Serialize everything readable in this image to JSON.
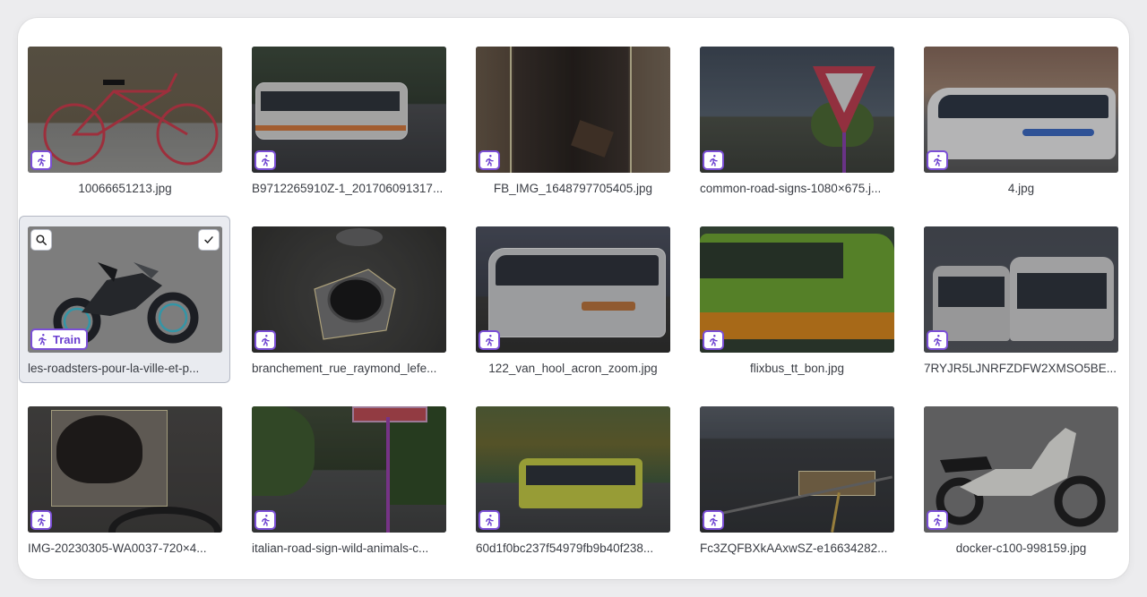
{
  "tag": {
    "train_label": "Train",
    "icon": "running-person-icon"
  },
  "controls": {
    "zoom_icon": "magnifier-icon",
    "select_icon": "checkmark-icon"
  },
  "colors": {
    "accent": "#7b4fd6",
    "panel": "#ffffff",
    "selected_card": "#e9ebf0"
  },
  "images": [
    {
      "filename": "10066651213.jpg",
      "name": "bicycle"
    },
    {
      "filename": "B9712265910Z-1_201706091317...",
      "name": "bus-street"
    },
    {
      "filename": "FB_IMG_1648797705405.jpg",
      "name": "hole-pit"
    },
    {
      "filename": "common-road-signs-1080×675.j...",
      "name": "yield-sign"
    },
    {
      "filename": "4.jpg",
      "name": "white-coach"
    },
    {
      "filename": "les-roadsters-pour-la-ville-et-p...",
      "name": "motorcycle",
      "selected": true
    },
    {
      "filename": "branchement_rue_raymond_lefe...",
      "name": "manhole"
    },
    {
      "filename": "122_van_hool_acron_zoom.jpg",
      "name": "coach"
    },
    {
      "filename": "flixbus_tt_bon.jpg",
      "name": "flixbus"
    },
    {
      "filename": "7RYJR5LJNRFZDFW2XMSO5BE...",
      "name": "two-buses"
    },
    {
      "filename": "IMG-20230305-WA0037-720×4...",
      "name": "pothole-tire"
    },
    {
      "filename": "italian-road-sign-wild-animals-c...",
      "name": "road-sign-pole"
    },
    {
      "filename": "60d1f0bc237f54979fb9b40f238...",
      "name": "yellow-bus"
    },
    {
      "filename": "Fc3ZQFBXkAAxwSZ-e16634282...",
      "name": "road-pothole"
    },
    {
      "filename": "docker-c100-998159.jpg",
      "name": "scooter"
    }
  ]
}
